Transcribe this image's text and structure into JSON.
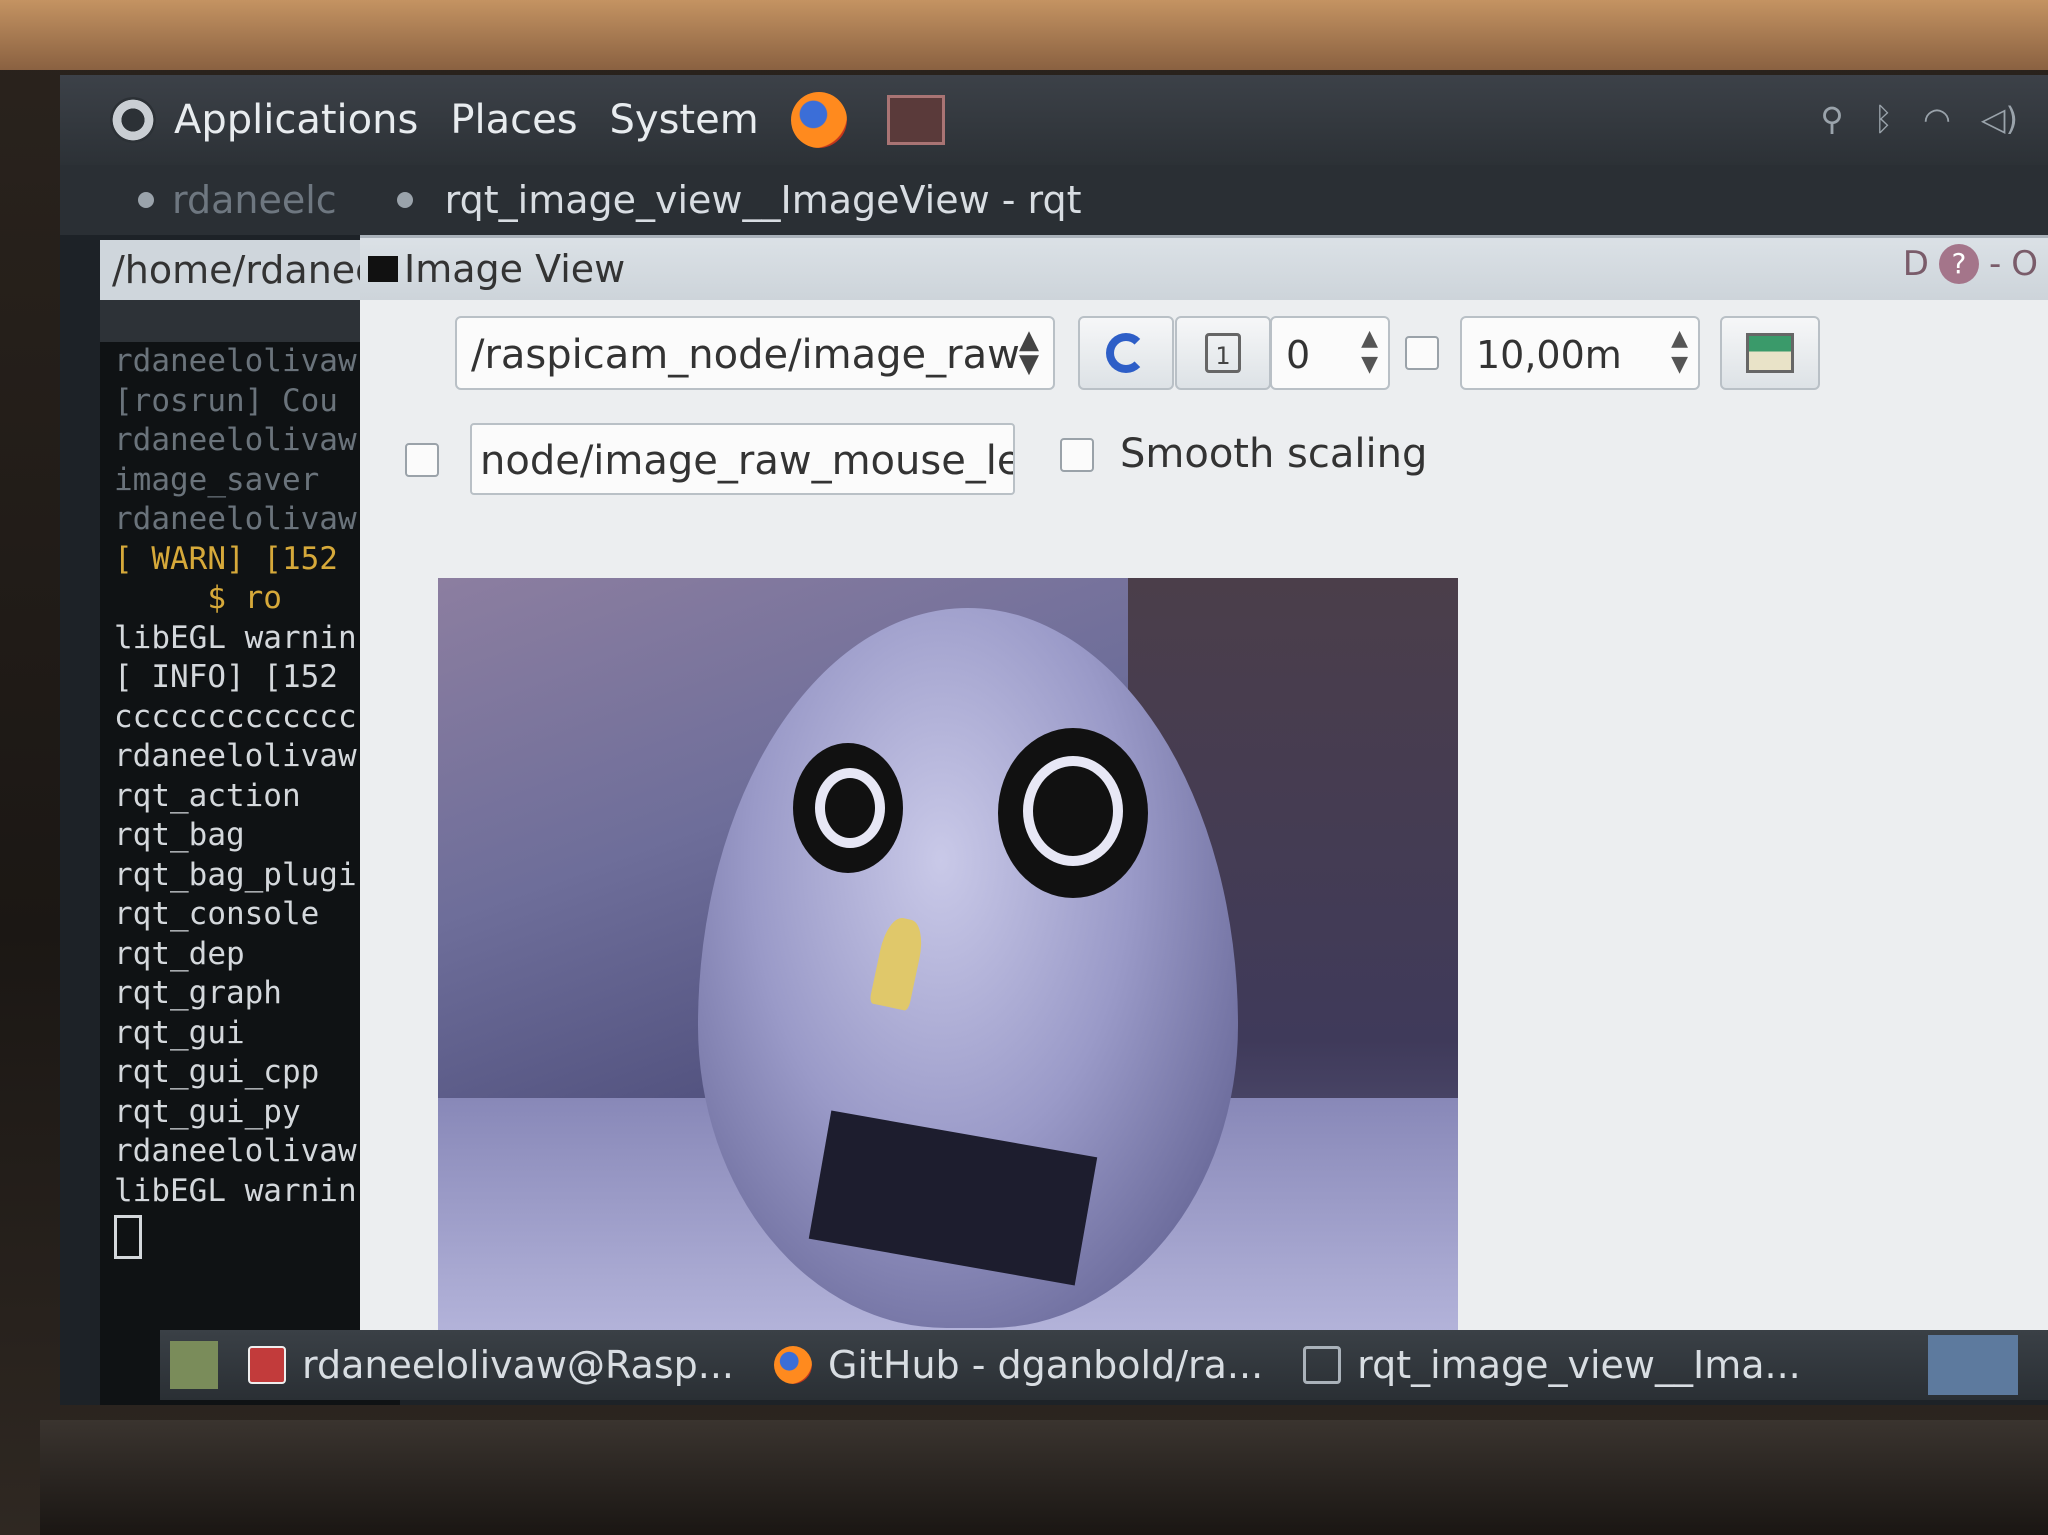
{
  "top_panel": {
    "menus": [
      "Applications",
      "Places",
      "System"
    ]
  },
  "title_row": {
    "faded_title": "rdaneelc",
    "active_title": "rqt_image_view__ImageView - rqt"
  },
  "terminal": {
    "path": "/home/rdanee",
    "lines": [
      {
        "text": "rdaneelolivaw",
        "style": "dim"
      },
      {
        "text": "[rosrun] Cou",
        "style": "dim"
      },
      {
        "text": "rdaneelolivaw",
        "style": "dim"
      },
      {
        "text": "image_saver",
        "style": "dim"
      },
      {
        "text": "rdaneelolivaw",
        "style": "dim"
      },
      {
        "text": "[ WARN] [152",
        "style": "warn"
      },
      {
        "text": "     $ ro",
        "style": "warn"
      },
      {
        "text": "libEGL warnin",
        "style": ""
      },
      {
        "text": "[ INFO] [152",
        "style": ""
      },
      {
        "text": "ccccccccccccc",
        "style": ""
      },
      {
        "text": "rdaneelolivaw",
        "style": ""
      },
      {
        "text": "rqt_action",
        "style": ""
      },
      {
        "text": "rqt_bag",
        "style": ""
      },
      {
        "text": "rqt_bag_plugi",
        "style": ""
      },
      {
        "text": "rqt_console",
        "style": ""
      },
      {
        "text": "rqt_dep",
        "style": ""
      },
      {
        "text": "rqt_graph",
        "style": ""
      },
      {
        "text": "rqt_gui",
        "style": ""
      },
      {
        "text": "rqt_gui_cpp",
        "style": ""
      },
      {
        "text": "rqt_gui_py",
        "style": ""
      },
      {
        "text": "rdaneelolivaw",
        "style": ""
      },
      {
        "text": "libEGL warnin",
        "style": ""
      }
    ]
  },
  "rqt": {
    "plugin_title": "Image View",
    "head_letter": "D",
    "help_glyph": "?",
    "minus_glyph": "-",
    "close_glyph": "O",
    "topic_value": "/raspicam_node/image_raw",
    "spin_value": "0",
    "max_range_value": "10,00m",
    "zoom_button_glyph": "1",
    "mouse_topic_value": "node/image_raw_mouse_left",
    "smooth_label": "Smooth scaling"
  },
  "taskbar": {
    "tasks": [
      {
        "label": "rdaneelolivaw@Rasp...",
        "icon": "terminal-icon"
      },
      {
        "label": "GitHub - dganbold/ra...",
        "icon": "firefox-icon"
      },
      {
        "label": "rqt_image_view__Ima...",
        "icon": "window-icon"
      }
    ]
  },
  "colors": {
    "panel": "#2c3136",
    "rqt_background": "#eceef0",
    "accent_blue": "#2d5ec7"
  }
}
